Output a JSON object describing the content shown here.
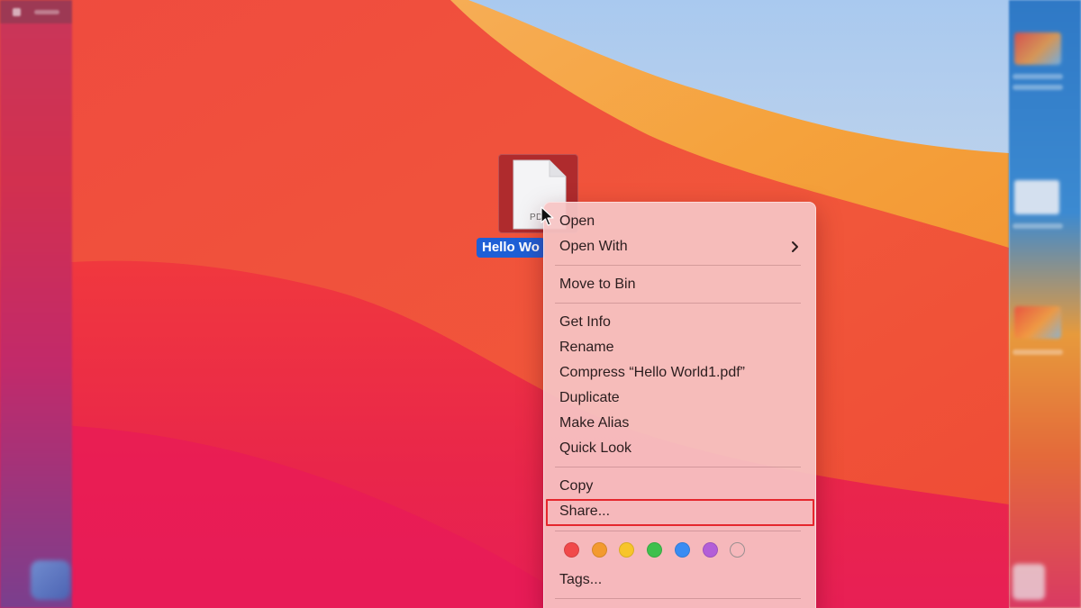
{
  "desktop": {
    "file": {
      "label": "Hello Wo",
      "icon": "pdf-document-icon",
      "extension": "PDF"
    }
  },
  "context_menu": {
    "groups": [
      {
        "items": [
          {
            "label": "Open"
          },
          {
            "label": "Open With",
            "has_submenu": true,
            "submenu_icon": "chevron-right-icon"
          }
        ]
      },
      {
        "items": [
          {
            "label": "Move to Bin"
          }
        ]
      },
      {
        "items": [
          {
            "label": "Get Info"
          },
          {
            "label": "Rename"
          },
          {
            "label": "Compress “Hello World1.pdf”"
          },
          {
            "label": "Duplicate"
          },
          {
            "label": "Make Alias"
          },
          {
            "label": "Quick Look"
          }
        ]
      },
      {
        "items": [
          {
            "label": "Copy"
          },
          {
            "label": "Share...",
            "highlighted": true,
            "highlight_color": "#e5262d"
          }
        ]
      }
    ],
    "tag_colors": [
      {
        "name": "red",
        "color": "#f1494a"
      },
      {
        "name": "orange",
        "color": "#f39a2f"
      },
      {
        "name": "yellow",
        "color": "#f7c52a"
      },
      {
        "name": "green",
        "color": "#3fc04d"
      },
      {
        "name": "blue",
        "color": "#3a8cf3"
      },
      {
        "name": "purple",
        "color": "#b35ed8"
      },
      {
        "name": "none",
        "color": ""
      }
    ],
    "tags_label": "Tags..."
  },
  "colors": {
    "selection_blue": "#1e5fd6",
    "highlight_red": "#e5262d"
  }
}
